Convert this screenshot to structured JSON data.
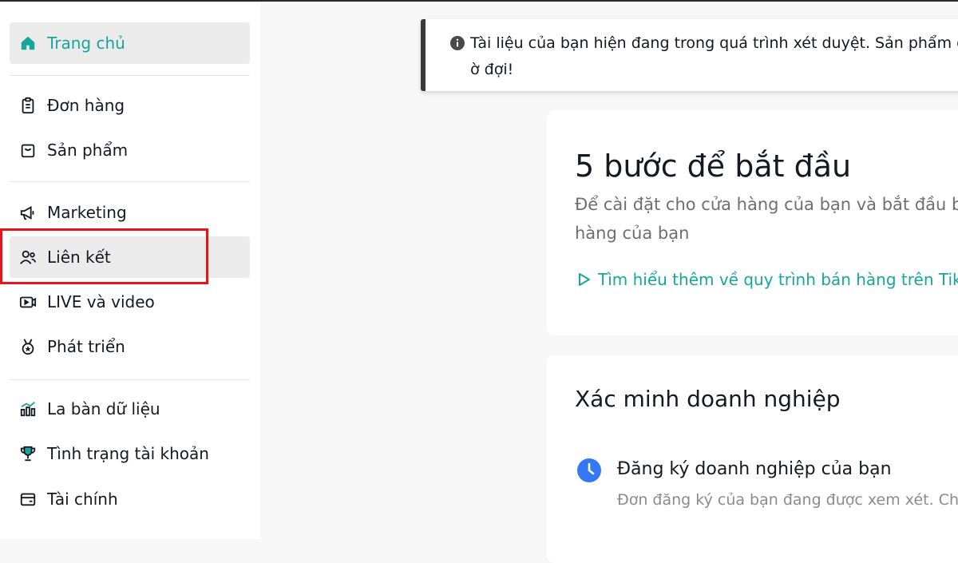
{
  "sidebar": {
    "items": [
      {
        "label": "Trang chủ",
        "icon": "home-icon"
      },
      {
        "label": "Đơn hàng",
        "icon": "clipboard-icon"
      },
      {
        "label": "Sản phẩm",
        "icon": "product-bag-icon"
      },
      {
        "label": "Marketing",
        "icon": "megaphone-icon"
      },
      {
        "label": "Liên kết",
        "icon": "users-icon"
      },
      {
        "label": "LIVE và video",
        "icon": "video-icon"
      },
      {
        "label": "Phát triển",
        "icon": "medal-icon"
      },
      {
        "label": "La bàn dữ liệu",
        "icon": "chart-icon"
      },
      {
        "label": "Tình trạng tài khoản",
        "icon": "trophy-icon"
      },
      {
        "label": "Tài chính",
        "icon": "wallet-icon"
      }
    ],
    "active_item": "Trang chủ",
    "highlighted_item": "Liên kết"
  },
  "notice": {
    "line1": "Tài liệu của bạn hiện đang trong quá trình xét duyệt. Sản phẩm c",
    "line2": "ờ đợi!",
    "icon": "info-icon"
  },
  "getting_started": {
    "title": "5 bước để bắt đầu",
    "desc_line1": "Để cài đặt cho cửa hàng của bạn và bắt đầu b",
    "desc_line2": "hàng của bạn",
    "link": "Tìm hiểu thêm về quy trình bán hàng trên TikTok"
  },
  "verification": {
    "title": "Xác minh doanh nghiệp",
    "step_title": "Đăng ký doanh nghiệp của bạn",
    "step_desc": "Đơn đăng ký của bạn đang được xem xét. Chú",
    "step_icon": "clock-icon"
  },
  "colors": {
    "accent": "#18a59b",
    "highlight_border": "#e6141b",
    "clock_blue": "#3478f6"
  }
}
